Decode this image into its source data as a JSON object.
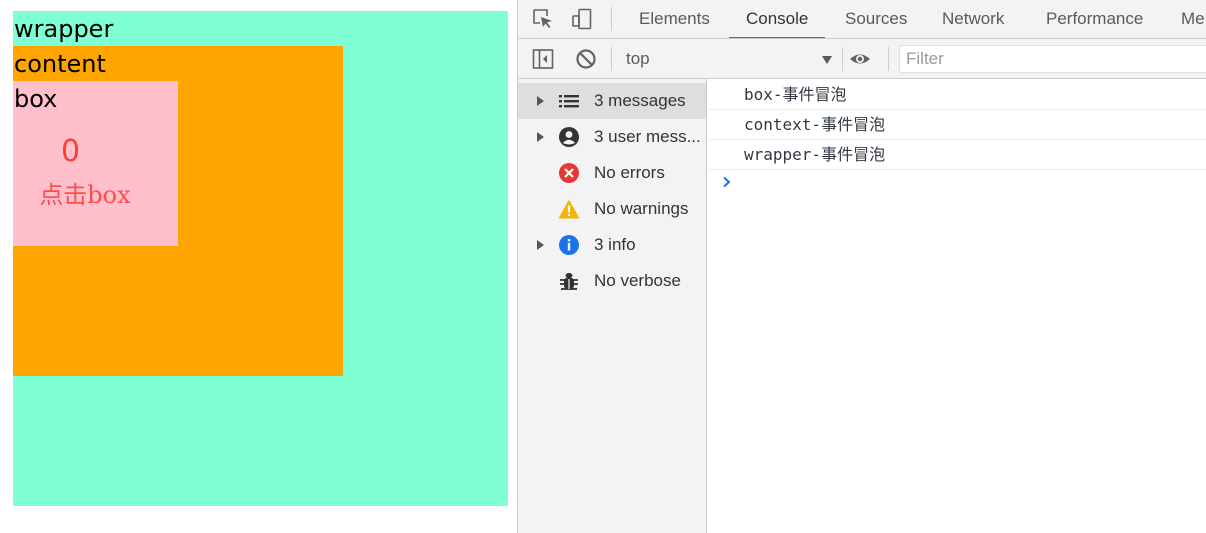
{
  "page": {
    "wrapper_label": "wrapper",
    "content_label": "content",
    "box_label": "box",
    "counter": "0",
    "click_text": "点击box",
    "colors": {
      "wrapper": "#7fffd4",
      "content": "#ffa500",
      "box": "#ffc0cb",
      "counter": "#ff3b3b"
    }
  },
  "devtools": {
    "toolbar_icons": [
      "inspect-element-icon",
      "device-toolbar-icon"
    ],
    "tabs": [
      {
        "label": "Elements"
      },
      {
        "label": "Console",
        "active": true
      },
      {
        "label": "Sources"
      },
      {
        "label": "Network"
      },
      {
        "label": "Performance"
      },
      {
        "label": "Me"
      }
    ],
    "console_toolbar": {
      "sidebar_toggle_icon": "sidebar-toggle-icon",
      "clear_icon": "clear-console-icon",
      "context": "top",
      "eye_icon": "live-expression-icon",
      "filter_placeholder": "Filter"
    },
    "sidebar": {
      "items": [
        {
          "label": "3 messages",
          "icon": "list-icon",
          "expandable": true,
          "selected": true
        },
        {
          "label": "3 user mess...",
          "icon": "user-icon",
          "expandable": true
        },
        {
          "label": "No errors",
          "icon": "error-icon",
          "expandable": false
        },
        {
          "label": "No warnings",
          "icon": "warning-icon",
          "expandable": false
        },
        {
          "label": "3 info",
          "icon": "info-icon",
          "expandable": true
        },
        {
          "label": "No verbose",
          "icon": "bug-icon",
          "expandable": false
        }
      ]
    },
    "logs": [
      {
        "text": "box-事件冒泡"
      },
      {
        "text": "context-事件冒泡"
      },
      {
        "text": "wrapper-事件冒泡"
      }
    ],
    "accent": "#1a73e8"
  }
}
